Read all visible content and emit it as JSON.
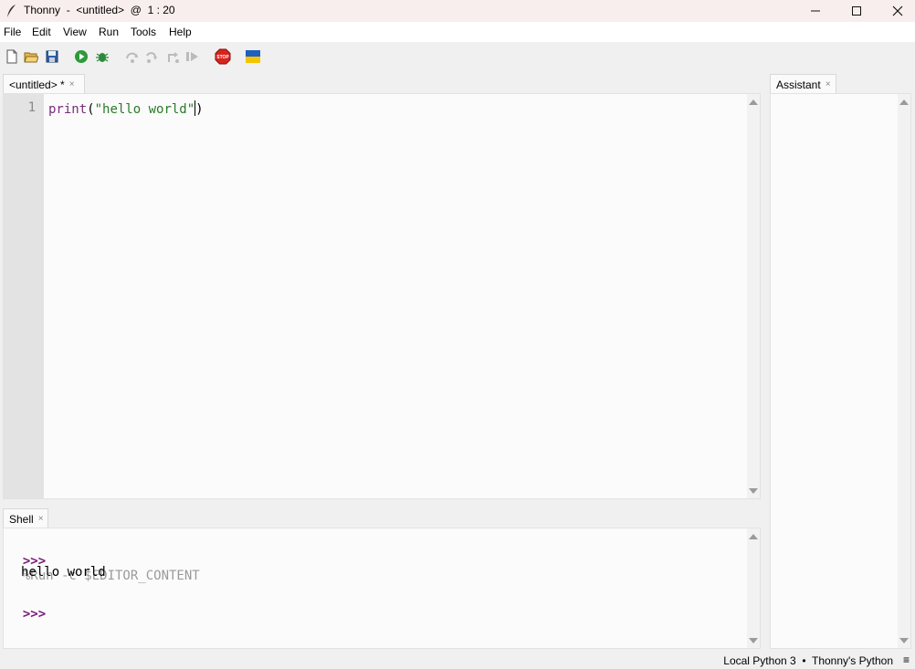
{
  "window": {
    "app_name": "Thonny",
    "title": "Thonny  -  <untitled>  @  1 : 20",
    "controls": {
      "minimize": "—",
      "maximize": "☐",
      "close": "✕"
    }
  },
  "menu": [
    "File",
    "Edit",
    "View",
    "Run",
    "Tools",
    "Help"
  ],
  "toolbar": {
    "icons": [
      "new-file-icon",
      "open-file-icon",
      "save-icon",
      "run-icon",
      "debug-icon",
      "step-over-icon",
      "step-into-icon",
      "step-out-icon",
      "resume-icon",
      "stop-icon",
      "ukraine-flag-icon"
    ],
    "stop_label": "STOP",
    "colors": {
      "run": "#2e9a3a",
      "stop": "#d8241c",
      "flag_blue": "#1f5fbf",
      "flag_yellow": "#f5c400"
    }
  },
  "editor": {
    "tab_label": "<untitled> *",
    "tab_close": "×",
    "line_number": "1",
    "code": {
      "func": "print",
      "open": "(",
      "string": "\"hello world\"",
      "close": ")"
    }
  },
  "shell": {
    "tab_label": "Shell",
    "tab_close": "×",
    "prompt": ">>>",
    "command": "%Run -c $EDITOR_CONTENT",
    "output": "hello world",
    "prompt2": ">>>"
  },
  "assistant": {
    "tab_label": "Assistant",
    "tab_close": "×"
  },
  "statusbar": {
    "interpreter": "Local Python 3  •  Thonny's Python",
    "menu_icon": "≡"
  }
}
